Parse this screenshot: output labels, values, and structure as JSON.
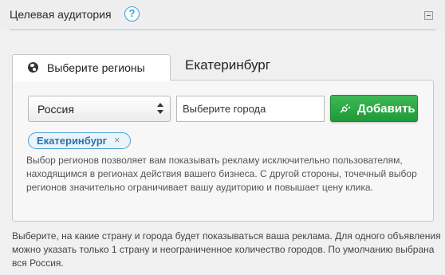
{
  "section": {
    "title": "Целевая аудитория",
    "help_label": "?"
  },
  "tabs": [
    {
      "label": "Выберите регионы",
      "icon": "globe-icon",
      "active": true
    },
    {
      "label": "Екатеринбург",
      "active": false
    }
  ],
  "region_form": {
    "country_select_value": "Россия",
    "city_input_placeholder": "Выберите города",
    "add_button_label": "Добавить",
    "add_button_icon": "plug-icon",
    "accent_color": "#22a03c"
  },
  "selected_cities": [
    {
      "label": "Екатеринбург",
      "remove_label": "×"
    }
  ],
  "panel_description": "Выбор регионов позволяет вам показывать рекламу исключительно пользователям, находящимся в регионах действия вашего бизнеса. С другой стороны, точечный выбор регионов значительно ограничивает вашу аудиторию и повышает цену клика.",
  "footer_note": "Выберите, на какие страну и города будет показываться ваша реклама. Для одного объявления можно указать только 1 страну и неограниченное количество городов. По умолчанию выбрана вся Россия."
}
